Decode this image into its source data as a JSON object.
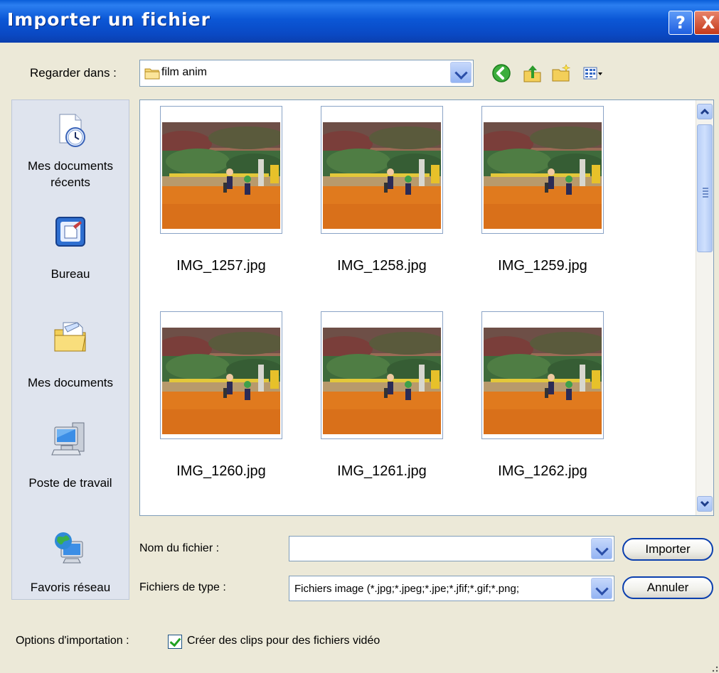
{
  "dialog": {
    "title": "Importer un fichier",
    "help_label": "?",
    "close_label": "X"
  },
  "lookin": {
    "label": "Regarder dans :",
    "value": "film anim"
  },
  "toolbar": {
    "icons": [
      "back-icon",
      "up-folder-icon",
      "new-folder-icon",
      "view-menu-icon"
    ]
  },
  "places": [
    {
      "label": "Mes documents récents",
      "icon": "recent-documents-icon"
    },
    {
      "label": "Bureau",
      "icon": "desktop-icon"
    },
    {
      "label": "Mes documents",
      "icon": "my-documents-icon"
    },
    {
      "label": "Poste de travail",
      "icon": "my-computer-icon"
    },
    {
      "label": "Favoris réseau",
      "icon": "network-places-icon"
    }
  ],
  "files": [
    {
      "name": "IMG_1257.jpg"
    },
    {
      "name": "IMG_1258.jpg"
    },
    {
      "name": "IMG_1259.jpg"
    },
    {
      "name": "IMG_1260.jpg"
    },
    {
      "name": "IMG_1261.jpg"
    },
    {
      "name": "IMG_1262.jpg"
    }
  ],
  "filename": {
    "label": "Nom du fichier :",
    "value": ""
  },
  "filetype": {
    "label": "Fichiers de type :",
    "value": "Fichiers image (*.jpg;*.jpeg;*.jpe;*.jfif;*.gif;*.png;"
  },
  "buttons": {
    "import": "Importer",
    "cancel": "Annuler"
  },
  "options": {
    "label": "Options d'importation :",
    "checkbox_label": "Créer des clips pour des fichiers vidéo",
    "checked": true
  },
  "colors": {
    "title_bar": "#0b57d6",
    "dialog_bg": "#ece9d8",
    "places_bg": "#dfe4ee"
  }
}
